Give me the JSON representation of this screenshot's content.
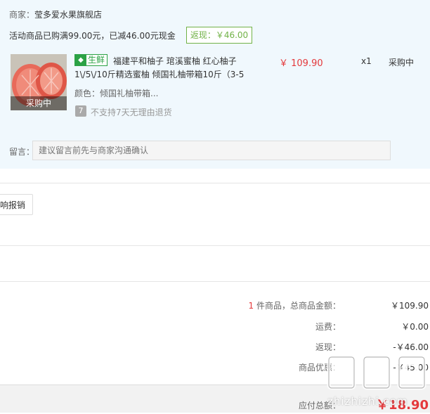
{
  "merchant": {
    "label": "商家：",
    "name": "莹多爱水果旗舰店"
  },
  "promotion": {
    "text": "活动商品已购满99.00元，已减46.00元现金",
    "rebate": "返现：￥46.00"
  },
  "product": {
    "thumb_overlay": "采购中",
    "badge_text": "生鲜",
    "title_line1": "福建平和柚子 琯溪蜜柚 红心柚子",
    "title_line2": "1\\/5\\/10斤精选蜜柚 倾国礼柚带箱10斤（3-5",
    "color_label": "颜色：倾国礼柚带箱...",
    "return_icon_text": "7",
    "return_policy": "不支持7天无理由退货",
    "price": "￥ 109.90",
    "quantity": "x1",
    "status": "采购中"
  },
  "message": {
    "label": "留言：",
    "placeholder": "建议留言前先与商家沟通确认"
  },
  "report_button": "响报销",
  "summary": {
    "count": "1",
    "count_suffix": "件商品，总商品金额：",
    "total_goods": "￥109.90",
    "shipping_label": "运费：",
    "shipping": "￥0.00",
    "rebate_label": "返现：",
    "rebate": "-￥46.00",
    "discount_label": "商品优惠：",
    "discount": "-￥45.00"
  },
  "footer": {
    "payable_label": "应付总额：",
    "payable": "￥18.90"
  },
  "watermark": {
    "text": "zhizhizhi.com"
  },
  "colors": {
    "accent_red": "#e4393c",
    "green": "#71b247",
    "fresh_green": "#2ba245",
    "panel_bg": "#f0f8fd"
  }
}
